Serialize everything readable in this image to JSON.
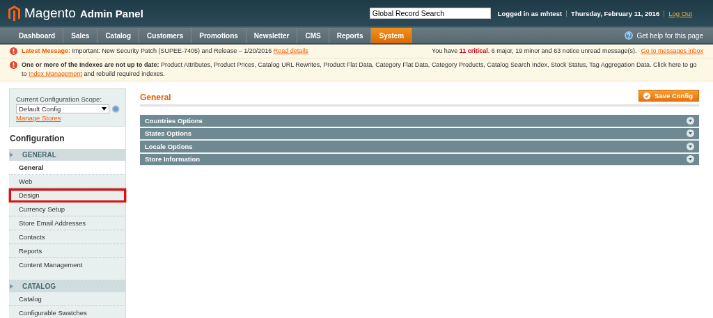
{
  "header": {
    "logo_word": "Magento",
    "logo_suffix": "Admin Panel",
    "search": {
      "value": "Global Record Search"
    },
    "user": "Logged in as mhtest",
    "date": "Thursday, February 11, 2016",
    "logout": "Log Out"
  },
  "nav": {
    "items": [
      {
        "label": "Dashboard",
        "selected": false
      },
      {
        "label": "Sales",
        "selected": false
      },
      {
        "label": "Catalog",
        "selected": false
      },
      {
        "label": "Customers",
        "selected": false
      },
      {
        "label": "Promotions",
        "selected": false
      },
      {
        "label": "Newsletter",
        "selected": false
      },
      {
        "label": "CMS",
        "selected": false
      },
      {
        "label": "Reports",
        "selected": false
      },
      {
        "label": "System",
        "selected": true
      }
    ],
    "help": "Get help for this page"
  },
  "messages": [
    {
      "lead": "Latest Message:",
      "text": "Important: New Security Patch (SUPEE-7405) and Release – 1/20/2016",
      "link": "Read details",
      "summary": "You have **11 critical**, 6 major, 19 minor and 63 notice unread message(s).",
      "summary_link": "Go to messages inbox"
    },
    {
      "lead": "One or more of the Indexes are not up to date:",
      "text": "Product Attributes, Product Prices, Catalog URL Rewrites, Product Flat Data, Category Flat Data, Category Products, Catalog Search Index, Stock Status, Tag Aggregation Data. Click here to go to",
      "link": "Index Management",
      "tail": "and rebuild required indexes."
    }
  ],
  "sidebar": {
    "scope_label": "Current Configuration Scope:",
    "scope_value": "Default Config",
    "manage_link": "Manage Stores",
    "title": "Configuration",
    "sections": [
      {
        "heading": "GENERAL",
        "items": [
          {
            "label": "General",
            "selected": true,
            "highlighted": false
          },
          {
            "label": "Web",
            "selected": false,
            "highlighted": false
          },
          {
            "label": "Design",
            "selected": false,
            "highlighted": true
          },
          {
            "label": "Currency Setup",
            "selected": false,
            "highlighted": false
          },
          {
            "label": "Store Email Addresses",
            "selected": false,
            "highlighted": false
          },
          {
            "label": "Contacts",
            "selected": false,
            "highlighted": false
          },
          {
            "label": "Reports",
            "selected": false,
            "highlighted": false
          },
          {
            "label": "Content Management",
            "selected": false,
            "highlighted": false
          }
        ]
      },
      {
        "heading": "CATALOG",
        "items": [
          {
            "label": "Catalog",
            "selected": false,
            "highlighted": false
          },
          {
            "label": "Configurable Swatches",
            "selected": false,
            "highlighted": false
          }
        ]
      }
    ]
  },
  "main": {
    "title": "General",
    "save_button": "Save Config",
    "groups": [
      {
        "label": "Countries Options",
        "expanded": false
      },
      {
        "label": "States Options",
        "expanded": false
      },
      {
        "label": "Locale Options",
        "expanded": false
      },
      {
        "label": "Store Information",
        "expanded": false
      }
    ]
  }
}
